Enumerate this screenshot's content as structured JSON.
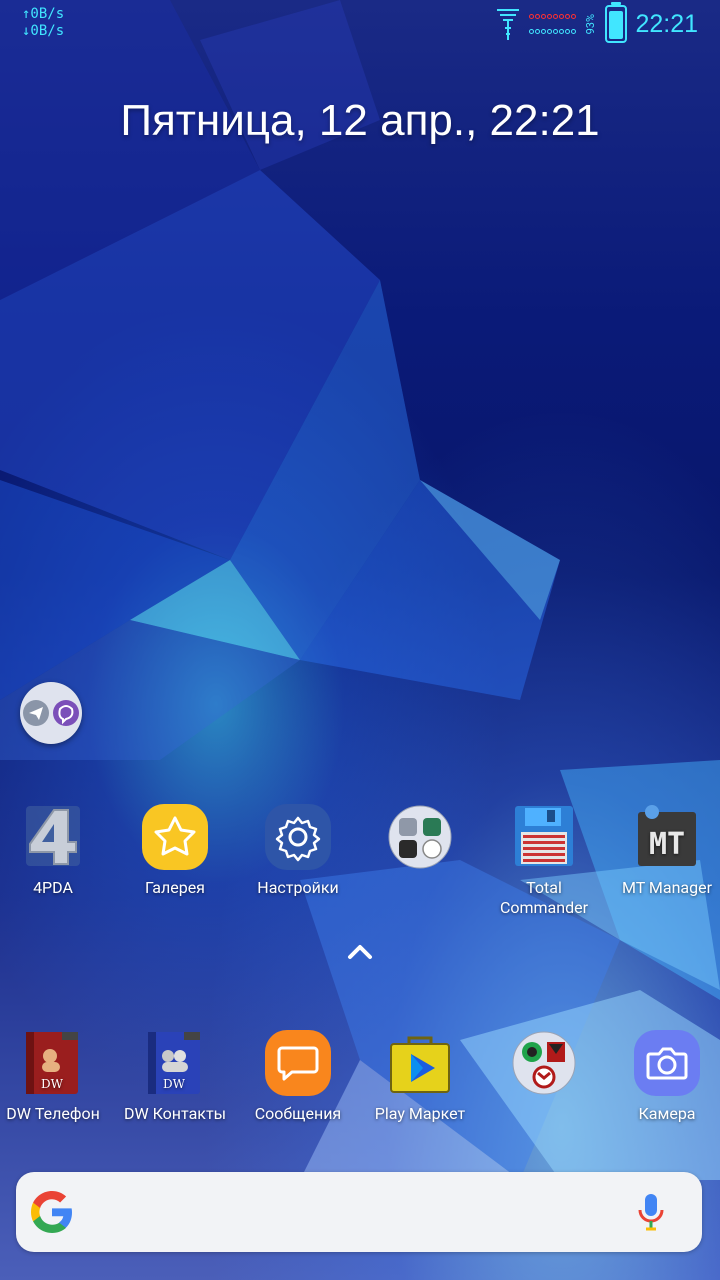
{
  "status_bar": {
    "upload_speed": "↑0B/s",
    "download_speed": "↓0B/s",
    "battery_percent_label": "93%",
    "battery_level": 0.93,
    "time": "22:21"
  },
  "home": {
    "date_time": "Пятница, 12 апр., 22:21",
    "folder": {
      "icons": [
        "telegram-icon",
        "viber-icon"
      ]
    }
  },
  "apps_row": [
    {
      "label": "4PDA",
      "icon": "4pda-icon"
    },
    {
      "label": "Галерея",
      "icon": "gallery-icon"
    },
    {
      "label": "Настройки",
      "icon": "settings-icon"
    },
    {
      "label": "",
      "icon": "folder-icon"
    },
    {
      "label": "Total Commander",
      "icon": "floppy-disk-icon"
    },
    {
      "label": "MT Manager",
      "icon": "mt-manager-icon"
    }
  ],
  "dock": [
    {
      "label": "DW Телефон",
      "icon": "dw-phone-icon"
    },
    {
      "label": "DW Контакты",
      "icon": "dw-contacts-icon"
    },
    {
      "label": "Сообщения",
      "icon": "messages-icon"
    },
    {
      "label": "Play Маркет",
      "icon": "play-market-icon"
    },
    {
      "label": "",
      "icon": "folder-icon"
    },
    {
      "label": "Камера",
      "icon": "camera-icon"
    }
  ],
  "search_bar": {
    "logo": "google-icon",
    "mic": "microphone-icon"
  },
  "colors": {
    "accent": "#41e6ff"
  }
}
